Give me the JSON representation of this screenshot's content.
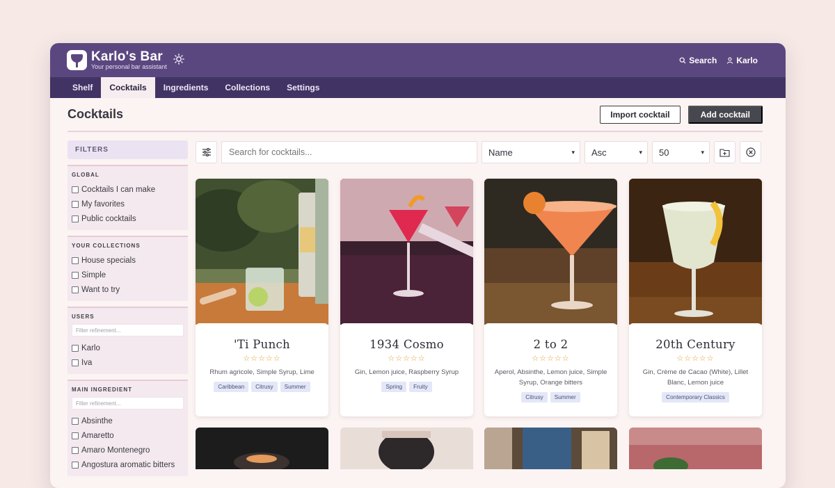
{
  "app": {
    "title": "Karlo's Bar",
    "subtitle": "Your personal bar assistant"
  },
  "header": {
    "search_label": "Search",
    "user_label": "Karlo"
  },
  "nav": {
    "tabs": [
      "Shelf",
      "Cocktails",
      "Ingredients",
      "Collections",
      "Settings"
    ],
    "active": "Cocktails"
  },
  "page": {
    "title": "Cocktails",
    "import_label": "Import cocktail",
    "add_label": "Add cocktail"
  },
  "toolbar": {
    "search_placeholder": "Search for cocktails...",
    "sort_field": "Name",
    "sort_order": "Asc",
    "per_page": "50"
  },
  "filters": {
    "title": "FILTERS",
    "global": {
      "title": "GLOBAL",
      "items": [
        "Cocktails I can make",
        "My favorites",
        "Public cocktails"
      ]
    },
    "collections": {
      "title": "YOUR COLLECTIONS",
      "items": [
        "House specials",
        "Simple",
        "Want to try"
      ]
    },
    "users": {
      "title": "USERS",
      "placeholder": "Filter refinement...",
      "items": [
        "Karlo",
        "Iva"
      ]
    },
    "main_ingredient": {
      "title": "MAIN INGREDIENT",
      "placeholder": "Filter refinement...",
      "items": [
        "Absinthe",
        "Amaretto",
        "Amaro Montenegro",
        "Angostura aromatic bitters"
      ]
    }
  },
  "cocktails": [
    {
      "name": "'Ti Punch",
      "stars": "☆☆☆☆☆",
      "ingredients": "Rhum agricole, Simple Syrup, Lime",
      "tags": [
        "Caribbean",
        "Citrusy",
        "Summer"
      ]
    },
    {
      "name": "1934 Cosmo",
      "stars": "☆☆☆☆☆",
      "ingredients": "Gin, Lemon juice, Raspberry Syrup",
      "tags": [
        "Spring",
        "Fruity"
      ]
    },
    {
      "name": "2 to 2",
      "stars": "☆☆☆☆☆",
      "ingredients": "Aperol, Absinthe, Lemon juice, Simple Syrup, Orange bitters",
      "tags": [
        "Citrusy",
        "Summer"
      ]
    },
    {
      "name": "20th Century",
      "stars": "☆☆☆☆☆",
      "ingredients": "Gin, Crème de Cacao (White), Lillet Blanc, Lemon juice",
      "tags": [
        "Contemporary Classics"
      ]
    }
  ],
  "colors": {
    "header": "#5b4780",
    "nav": "#413464",
    "accent_tag": "#e3e7f7",
    "stars": "#e29a2c"
  }
}
